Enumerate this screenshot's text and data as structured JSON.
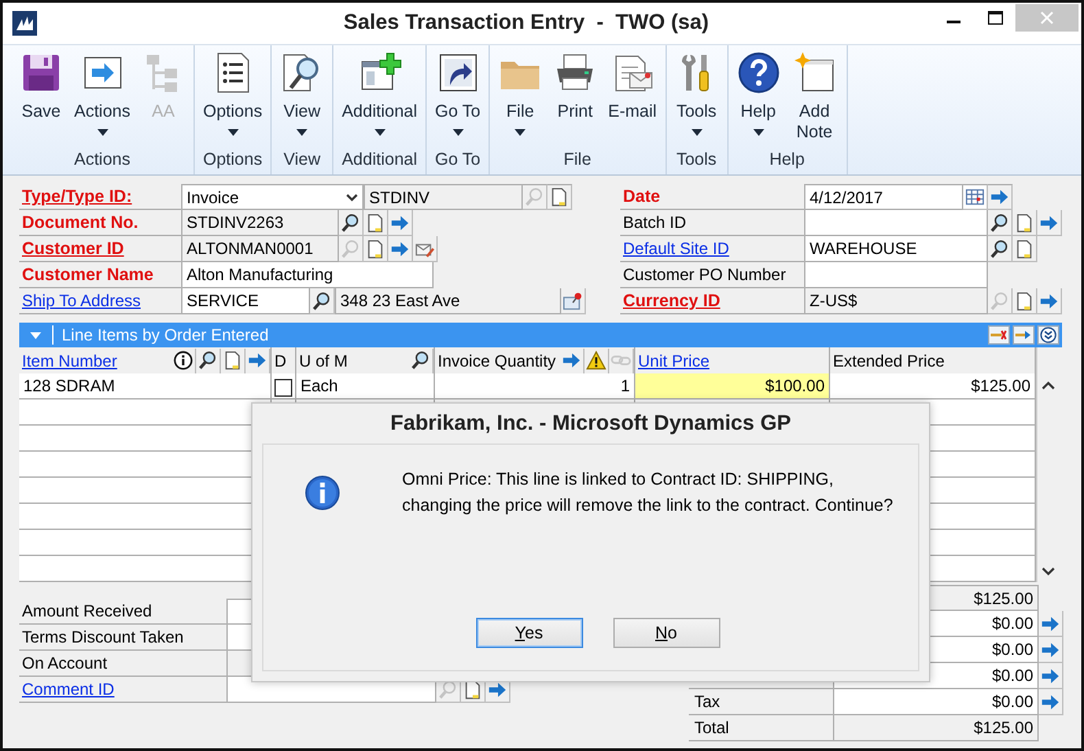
{
  "window": {
    "title": "Sales Transaction Entry  -  TWO (sa)"
  },
  "ribbon": [
    {
      "label": "Actions",
      "buttons": [
        {
          "label": "Save",
          "dropdown": false,
          "disabled": false
        },
        {
          "label": "Actions",
          "dropdown": true,
          "disabled": false
        },
        {
          "label": "AA",
          "dropdown": false,
          "disabled": true
        }
      ]
    },
    {
      "label": "Options",
      "buttons": [
        {
          "label": "Options",
          "dropdown": true,
          "disabled": false
        }
      ]
    },
    {
      "label": "View",
      "buttons": [
        {
          "label": "View",
          "dropdown": true,
          "disabled": false
        }
      ]
    },
    {
      "label": "Additional",
      "buttons": [
        {
          "label": "Additional",
          "dropdown": true,
          "disabled": false
        }
      ]
    },
    {
      "label": "Go To",
      "buttons": [
        {
          "label": "Go To",
          "dropdown": true,
          "disabled": false
        }
      ]
    },
    {
      "label": "File",
      "buttons": [
        {
          "label": "File",
          "dropdown": true,
          "disabled": false
        },
        {
          "label": "Print",
          "dropdown": false,
          "disabled": false
        },
        {
          "label": "E-mail",
          "dropdown": false,
          "disabled": false
        }
      ]
    },
    {
      "label": "Tools",
      "buttons": [
        {
          "label": "Tools",
          "dropdown": true,
          "disabled": false
        }
      ]
    },
    {
      "label": "Help",
      "buttons": [
        {
          "label": "Help",
          "dropdown": true,
          "disabled": false
        },
        {
          "label": "Add Note",
          "dropdown": false,
          "disabled": false
        }
      ]
    }
  ],
  "header_left": [
    {
      "label": "Type/Type ID:",
      "kind": "required_link",
      "parts": [
        {
          "kind": "dropdown",
          "value": "Invoice",
          "editable": true
        },
        {
          "kind": "field",
          "value": "STDINV",
          "editable": false
        },
        {
          "kind": "lookup",
          "disabled": true
        },
        {
          "kind": "note"
        }
      ]
    },
    {
      "label": "Document No.",
      "kind": "required",
      "parts": [
        {
          "kind": "field",
          "value": "STDINV2263",
          "editable": false
        },
        {
          "kind": "lookup",
          "disabled": false
        },
        {
          "kind": "note"
        },
        {
          "kind": "arrow"
        }
      ]
    },
    {
      "label": "Customer ID",
      "kind": "required_link",
      "parts": [
        {
          "kind": "field",
          "value": "ALTONMAN0001",
          "editable": false
        },
        {
          "kind": "lookup",
          "disabled": true
        },
        {
          "kind": "note"
        },
        {
          "kind": "arrow"
        },
        {
          "kind": "envelope"
        }
      ]
    },
    {
      "label": "Customer Name",
      "kind": "required",
      "parts": [
        {
          "kind": "field",
          "value": "Alton Manufacturing",
          "editable": true
        }
      ]
    },
    {
      "label": "Ship To Address",
      "kind": "link",
      "parts": [
        {
          "kind": "field",
          "value": "SERVICE",
          "editable": true
        },
        {
          "kind": "lookup",
          "disabled": false
        },
        {
          "kind": "field",
          "value": "348 23 East Ave",
          "editable": false
        },
        {
          "kind": "pin"
        }
      ]
    }
  ],
  "header_right": [
    {
      "label": "Date",
      "kind": "required",
      "parts": [
        {
          "kind": "field",
          "value": "4/12/2017",
          "editable": true
        },
        {
          "kind": "calendar"
        },
        {
          "kind": "arrow"
        }
      ]
    },
    {
      "label": "Batch ID",
      "kind": "plain",
      "parts": [
        {
          "kind": "field",
          "editable": true
        },
        {
          "kind": "lookup",
          "disabled": false
        },
        {
          "kind": "note"
        },
        {
          "kind": "arrow"
        }
      ]
    },
    {
      "label": "Default Site ID",
      "kind": "link",
      "parts": [
        {
          "kind": "field",
          "value": "WAREHOUSE",
          "editable": true
        },
        {
          "kind": "lookup",
          "disabled": false
        },
        {
          "kind": "note"
        }
      ]
    },
    {
      "label": "Customer PO Number",
      "kind": "plain",
      "parts": [
        {
          "kind": "field",
          "editable": true
        }
      ]
    },
    {
      "label": "Currency ID",
      "kind": "required_link",
      "parts": [
        {
          "kind": "field",
          "value": "Z-US$",
          "editable": false
        },
        {
          "kind": "lookup",
          "disabled": true
        },
        {
          "kind": "note"
        },
        {
          "kind": "arrow"
        }
      ]
    }
  ],
  "line_items": {
    "title": "Line Items by Order Entered",
    "expanded": true,
    "columns": [
      {
        "label": "Item Number",
        "link": true,
        "parts": [
          {
            "kind": "info"
          },
          {
            "kind": "lookup",
            "disabled": false
          },
          {
            "kind": "note"
          },
          {
            "kind": "arrow"
          }
        ]
      },
      {
        "label": "D",
        "link": false
      },
      {
        "label": "U of M",
        "link": false,
        "parts": [
          {
            "kind": "lookup",
            "disabled": false
          }
        ]
      },
      {
        "label": "Invoice Quantity",
        "link": false,
        "parts": [
          {
            "kind": "arrow"
          },
          {
            "kind": "warning"
          },
          {
            "kind": "chain",
            "disabled": true
          }
        ]
      },
      {
        "label": "Unit Price",
        "link": true
      },
      {
        "label": "Extended Price",
        "link": false
      }
    ],
    "rows": [
      {
        "cells": [
          {
            "value": "128 SDRAM",
            "focused": false
          },
          {
            "checked": false,
            "focused": false
          },
          {
            "value": "Each",
            "focused": false
          },
          {
            "value": "1",
            "focused": false
          },
          {
            "value": "$100.00",
            "focused": true
          },
          {
            "value": "$125.00",
            "focused": false
          }
        ]
      }
    ]
  },
  "bottom_left": [
    {
      "label": "Amount Received",
      "kind": "plain",
      "parts": [
        {
          "kind": "field",
          "editable": true
        }
      ]
    },
    {
      "label": "Terms Discount Taken",
      "kind": "plain",
      "parts": [
        {
          "kind": "field",
          "editable": true
        }
      ]
    },
    {
      "label": "On Account",
      "kind": "plain",
      "parts": [
        {
          "kind": "field",
          "editable": false
        }
      ]
    },
    {
      "label": "Comment ID",
      "kind": "link",
      "parts": [
        {
          "kind": "field",
          "editable": true
        },
        {
          "kind": "lookup",
          "disabled": true
        },
        {
          "kind": "note"
        },
        {
          "kind": "arrow"
        }
      ]
    }
  ],
  "totals": [
    {
      "value": "$125.00",
      "editable": false
    },
    {
      "value": "$0.00",
      "editable": true
    },
    {
      "value": "$0.00",
      "editable": true
    },
    {
      "value": "$0.00",
      "editable": true
    },
    {
      "label": "Tax",
      "value": "$0.00",
      "editable": true
    },
    {
      "label": "Total",
      "value": "$125.00",
      "editable": false
    }
  ],
  "dialog": {
    "title": "Fabrikam, Inc. - Microsoft Dynamics GP",
    "message": "Omni Price: This line is linked to Contract ID: SHIPPING,\nchanging the price will remove the link to the contract. Continue?",
    "buttons": [
      {
        "label": "Yes",
        "focused": true
      },
      {
        "label": "No",
        "focused": false
      }
    ]
  }
}
